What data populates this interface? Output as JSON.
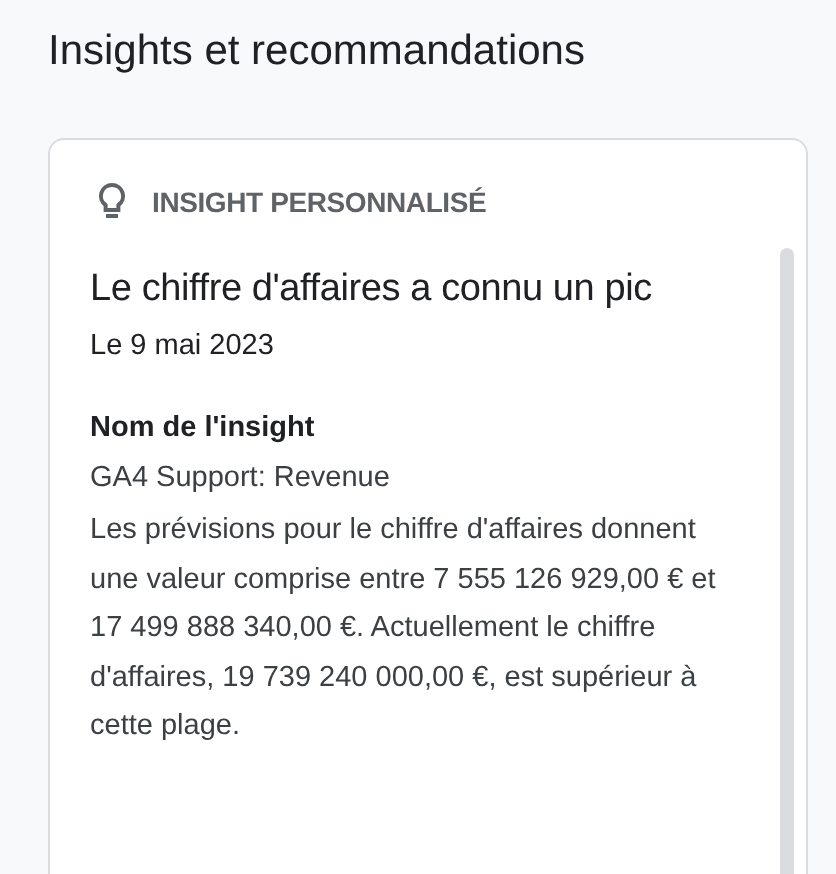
{
  "page_title": "Insights et recommandations",
  "card": {
    "label": "INSIGHT PERSONNALISÉ",
    "title": "Le chiffre d'affaires a connu un pic",
    "date": "Le 9 mai 2023",
    "field_label": "Nom de l'insight",
    "field_value": "GA4 Support: Revenue",
    "description": "Les prévisions pour le chiffre d'affaires donnent une valeur comprise entre 7 555 126 929,00 € et 17 499 888 340,00 €. Actuellement le chiffre d'affaires, 19 739 240 000,00 €, est supérieur à cette plage."
  }
}
